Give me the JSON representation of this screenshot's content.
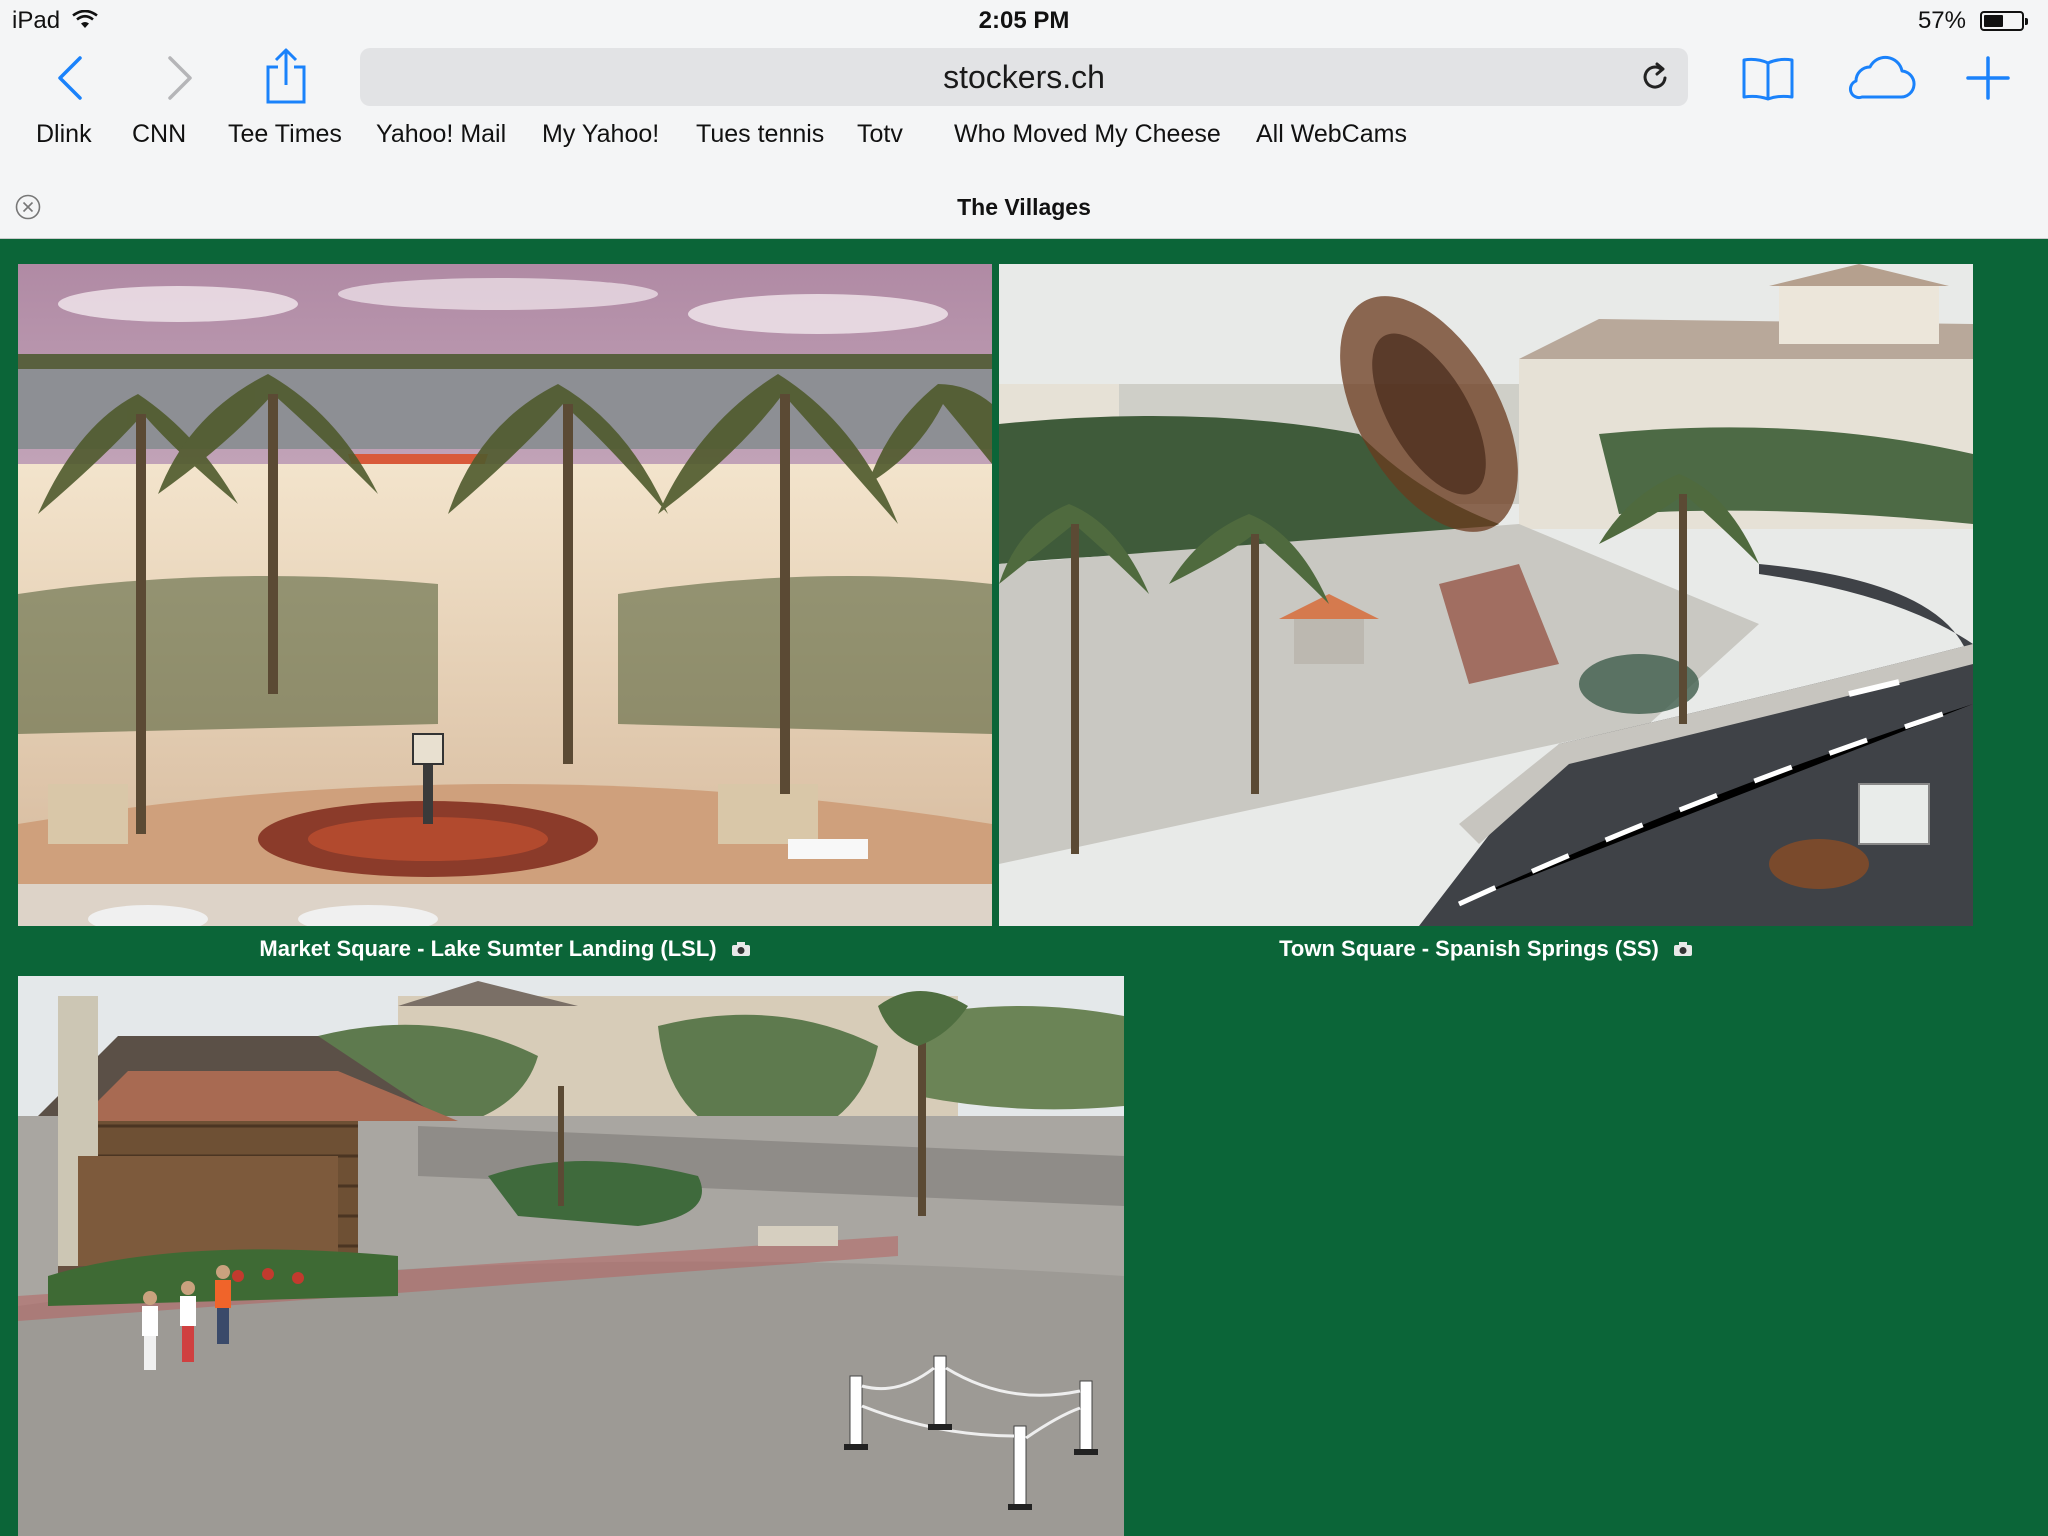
{
  "status": {
    "device": "iPad",
    "time": "2:05 PM",
    "battery": "57%",
    "battery_level": 0.57
  },
  "toolbar": {
    "url": "stockers.ch",
    "icons": [
      "back-icon",
      "forward-icon",
      "share-icon",
      "reload-icon",
      "bookmarks-icon",
      "icloud-tabs-icon",
      "new-tab-icon"
    ]
  },
  "favorites": [
    "Dlink",
    "CNN",
    "Tee Times",
    "Yahoo! Mail",
    "My Yahoo!",
    "Tues tennis",
    "Totv",
    "Who Moved My Cheese",
    "All WebCams"
  ],
  "tab": {
    "title": "The Villages"
  },
  "webcams": [
    {
      "caption": "Market Square - Lake Sumter Landing (LSL)"
    },
    {
      "caption": "Town Square - Spanish Springs (SS)"
    },
    {
      "caption": ""
    }
  ],
  "colors": {
    "page_background": "#0b6538",
    "accent": "#1a82fb",
    "chrome": "#f4f5f6"
  }
}
